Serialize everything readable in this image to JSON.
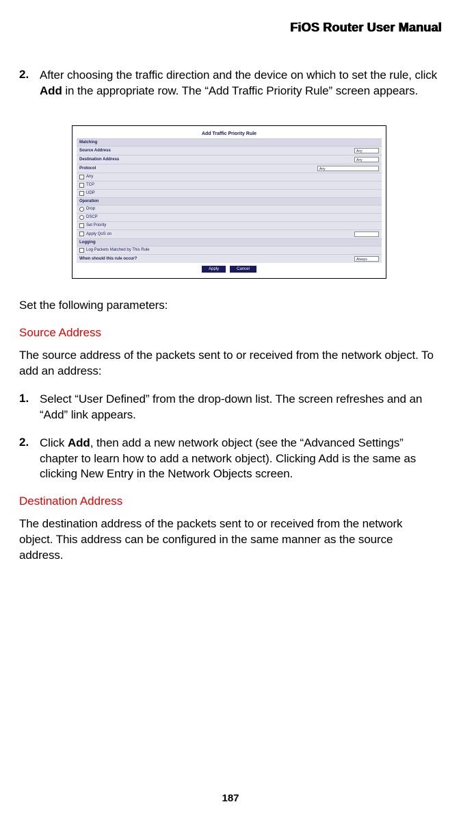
{
  "header": {
    "title": "FiOS Router User Manual"
  },
  "step2": {
    "num": "2.",
    "text_before": "After choosing the traffic direction and the device on which to set the rule, click ",
    "bold": "Add",
    "text_after": " in the appropriate row. The “Add Traffic Priority Rule” screen appears."
  },
  "screenshot": {
    "title": "Add Traffic Priority Rule",
    "rows": {
      "matching": "Matching",
      "source": "Source Address",
      "dest": "Destination Address",
      "protocol": "Protocol",
      "opt_any": "Any",
      "opt_tcp": "TCP",
      "opt_udp": "UDP",
      "operation": "Operation",
      "drop": "Drop",
      "dscp": "DSCP",
      "priority": "Set Priority",
      "tx_queue": "Apply QoS on",
      "logging": "Logging",
      "log_packets": "Log Packets Matched by This Rule",
      "when_active": "When should this rule occur?",
      "select_any": "Any",
      "select_always": "Always"
    },
    "buttons": {
      "apply": "Apply",
      "cancel": "Cancel"
    }
  },
  "text": {
    "set_params": "Set the following parameters:",
    "src_heading": "Source Address",
    "src_para": "The source address of the packets sent to or received from the network object. To add an address:",
    "src_step1_num": "1.",
    "src_step1": "Select “User Defined” from the drop-down list. The screen refreshes and an “Add” link appears.",
    "src_step2_num": "2.",
    "src_step2_before": "Click ",
    "src_step2_bold": "Add",
    "src_step2_after": ", then add a new network object (see the “Advanced Settings” chapter to learn how to add a network object). Clicking Add is the same as clicking New Entry in the Network Objects screen.",
    "dst_heading": "Destination Address",
    "dst_para": "The destination address of the packets sent to or received from the network object. This address can be configured in the same manner as the source address."
  },
  "page_number": "187"
}
